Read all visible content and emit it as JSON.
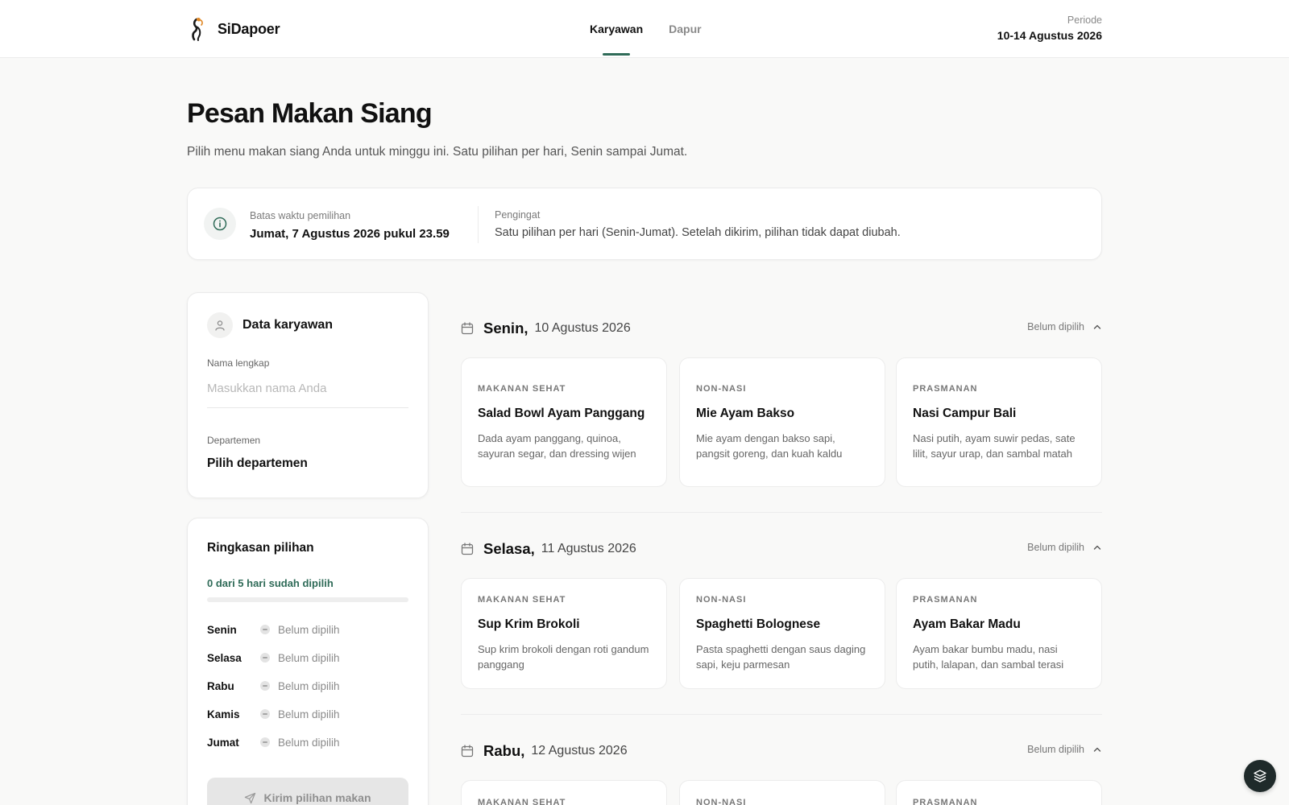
{
  "header": {
    "brand": "SiDapoer",
    "tabs": [
      {
        "label": "Karyawan",
        "active": true
      },
      {
        "label": "Dapur",
        "active": false
      }
    ],
    "period_label": "Periode",
    "period_value": "10-14 Agustus 2026"
  },
  "page": {
    "title": "Pesan Makan Siang",
    "subtitle": "Pilih menu makan siang Anda untuk minggu ini. Satu pilihan per hari, Senin sampai Jumat."
  },
  "banner": {
    "deadline_label": "Batas waktu pemilihan",
    "deadline_value": "Jumat, 7 Agustus 2026 pukul 23.59",
    "reminder_label": "Pengingat",
    "reminder_value": "Satu pilihan per hari (Senin-Jumat). Setelah dikirim, pilihan tidak dapat diubah."
  },
  "employee": {
    "title": "Data karyawan",
    "name_label": "Nama lengkap",
    "name_value": "",
    "name_placeholder": "Masukkan nama Anda",
    "dept_label": "Departemen",
    "dept_value": "Pilih departemen"
  },
  "summary": {
    "title": "Ringkasan pilihan",
    "progress_text": "0 dari 5 hari sudah dipilih",
    "progress_fraction": 0,
    "rows": [
      {
        "day": "Senin",
        "status": "Belum dipilih"
      },
      {
        "day": "Selasa",
        "status": "Belum dipilih"
      },
      {
        "day": "Rabu",
        "status": "Belum dipilih"
      },
      {
        "day": "Kamis",
        "status": "Belum dipilih"
      },
      {
        "day": "Jumat",
        "status": "Belum dipilih"
      }
    ],
    "submit_label": "Kirim pilihan makan"
  },
  "days": [
    {
      "name": "Senin,",
      "date": "10 Agustus 2026",
      "status": "Belum dipilih",
      "menus": [
        {
          "category": "MAKANAN SEHAT",
          "name": "Salad Bowl Ayam Panggang",
          "desc": "Dada ayam panggang, quinoa, sayuran segar, dan dressing wijen"
        },
        {
          "category": "NON-NASI",
          "name": "Mie Ayam Bakso",
          "desc": "Mie ayam dengan bakso sapi, pangsit goreng, dan kuah kaldu"
        },
        {
          "category": "PRASMANAN",
          "name": "Nasi Campur Bali",
          "desc": "Nasi putih, ayam suwir pedas, sate lilit, sayur urap, dan sambal matah"
        }
      ]
    },
    {
      "name": "Selasa,",
      "date": "11 Agustus 2026",
      "status": "Belum dipilih",
      "menus": [
        {
          "category": "MAKANAN SEHAT",
          "name": "Sup Krim Brokoli",
          "desc": "Sup krim brokoli dengan roti gandum panggang"
        },
        {
          "category": "NON-NASI",
          "name": "Spaghetti Bolognese",
          "desc": "Pasta spaghetti dengan saus daging sapi, keju parmesan"
        },
        {
          "category": "PRASMANAN",
          "name": "Ayam Bakar Madu",
          "desc": "Ayam bakar bumbu madu, nasi putih, lalapan, dan sambal terasi"
        }
      ]
    },
    {
      "name": "Rabu,",
      "date": "12 Agustus 2026",
      "status": "Belum dipilih",
      "menus": [
        {
          "category": "MAKANAN SEHAT",
          "name": "",
          "desc": ""
        },
        {
          "category": "NON-NASI",
          "name": "",
          "desc": ""
        },
        {
          "category": "PRASMANAN",
          "name": "",
          "desc": ""
        }
      ]
    }
  ],
  "colors": {
    "accent": "#2f6b58",
    "background": "#f9f9f8"
  },
  "icons": {
    "brand": "flame-dancer-logo",
    "banner": "info-icon",
    "employee": "user-icon",
    "day": "calendar-icon",
    "collapse": "chevron-up-icon",
    "submit": "send-icon",
    "fab": "layers-icon"
  }
}
